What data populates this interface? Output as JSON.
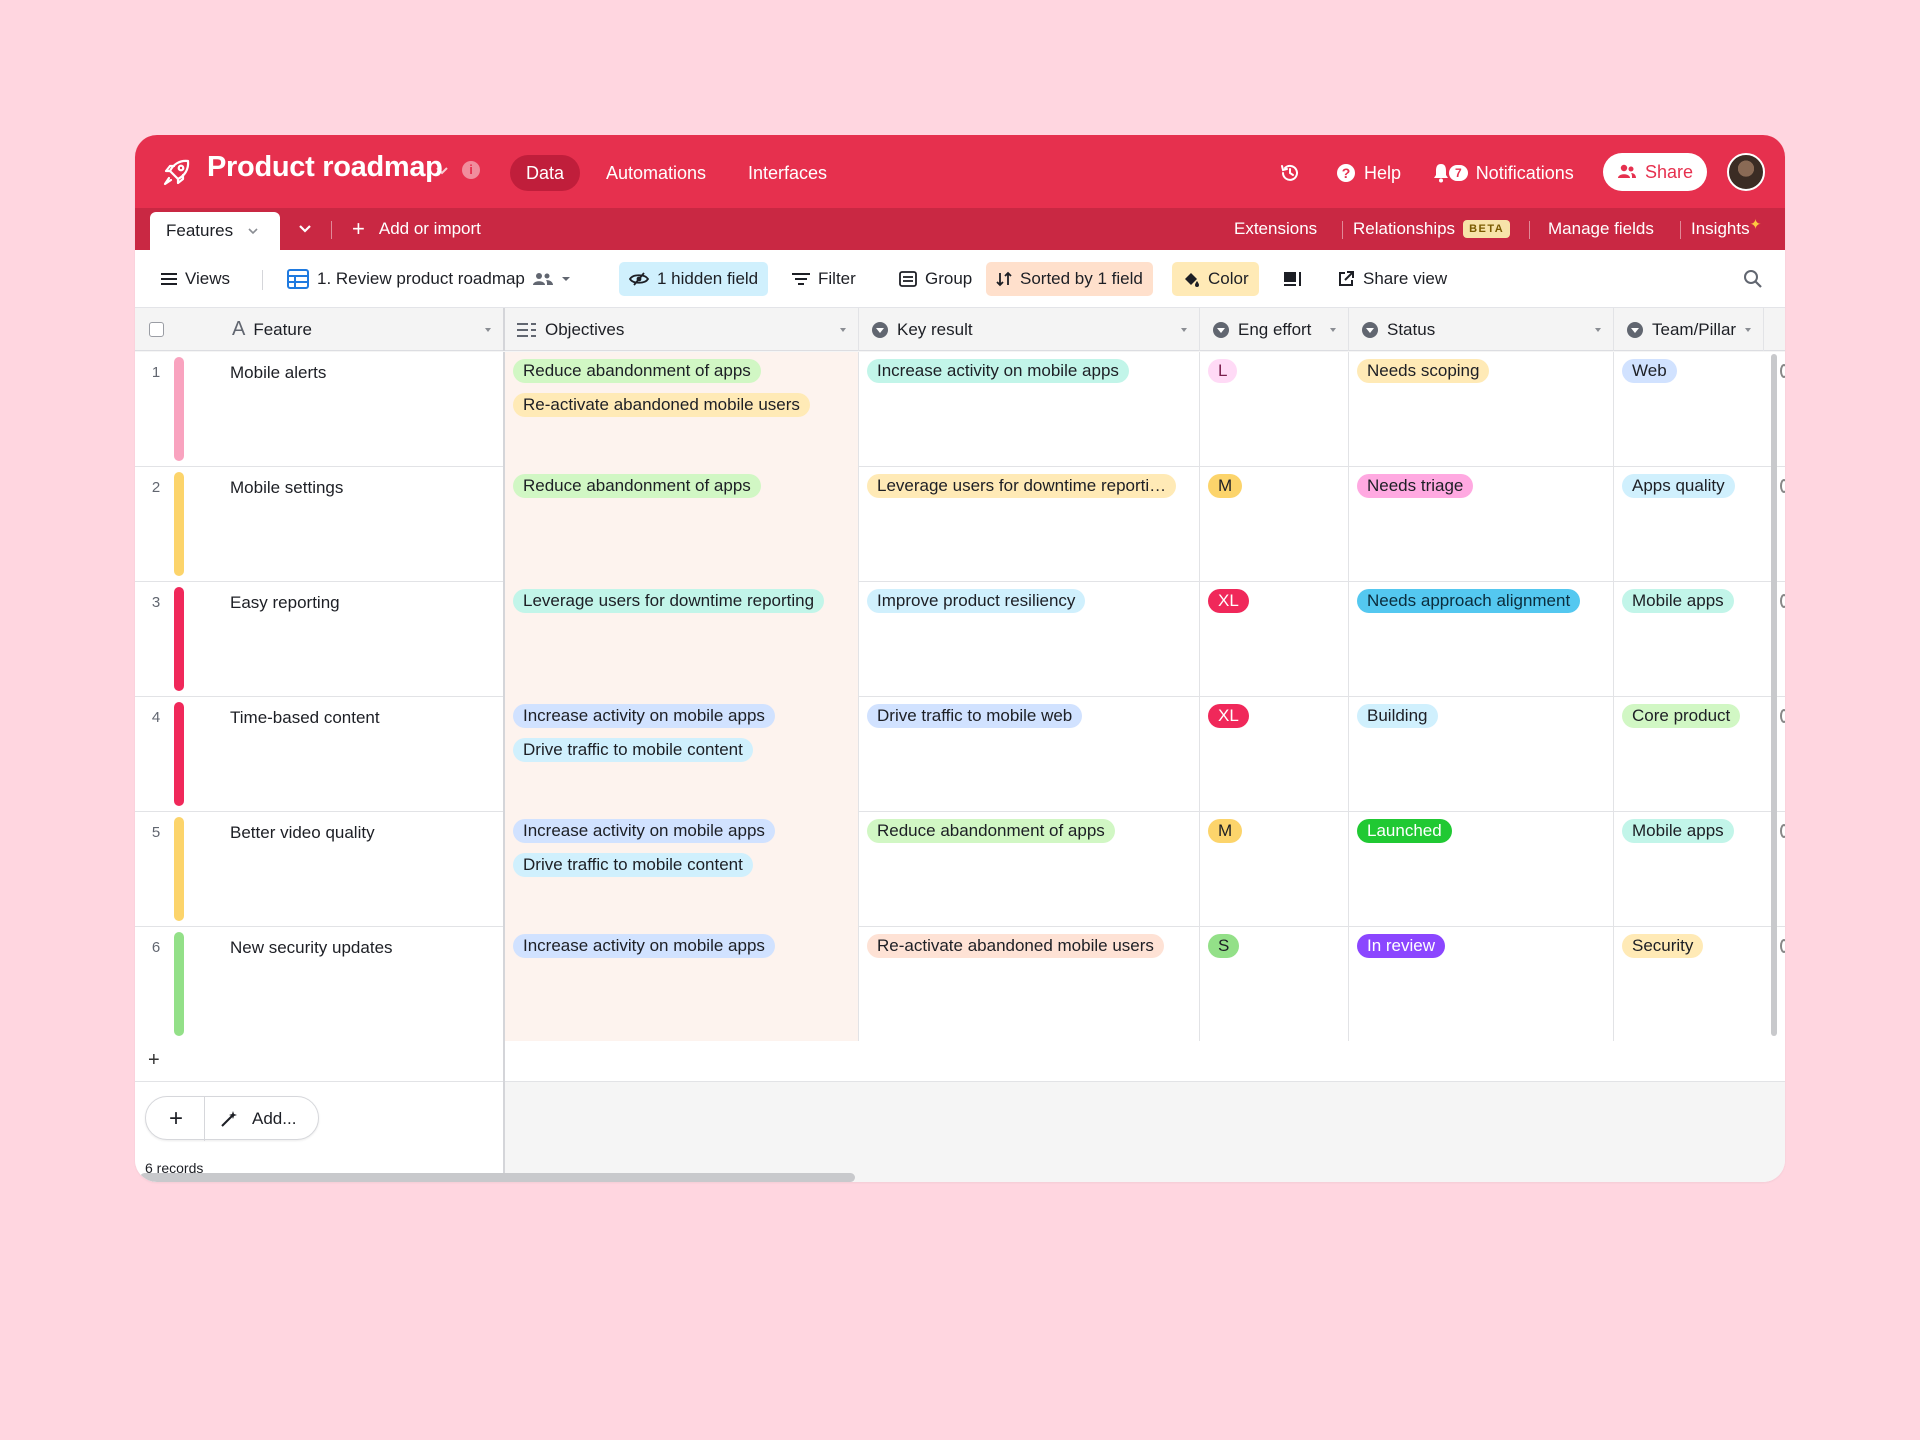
{
  "app": {
    "title": "Product roadmap",
    "nav_tabs": [
      {
        "label": "Data",
        "active": true
      },
      {
        "label": "Automations",
        "active": false
      },
      {
        "label": "Interfaces",
        "active": false
      }
    ],
    "help_label": "Help",
    "notifications_label": "Notifications",
    "notifications_count": "7",
    "share_label": "Share",
    "accent_color": "#e6304e"
  },
  "tablebar": {
    "table_tab": "Features",
    "add_import": "Add or import",
    "extensions": "Extensions",
    "relationships": "Relationships",
    "beta": "BETA",
    "manage_fields": "Manage fields",
    "insights": "Insights"
  },
  "toolbar": {
    "views": "Views",
    "view_name": "1. Review product roadmap",
    "hidden_field": "1 hidden field",
    "filter": "Filter",
    "group": "Group",
    "sorted": "Sorted by 1 field",
    "color": "Color",
    "share_view": "Share view"
  },
  "columns": {
    "feature": "Feature",
    "objectives": "Objectives",
    "key_result": "Key result",
    "eng_effort": "Eng effort",
    "status": "Status",
    "team": "Team/Pillar"
  },
  "rows": [
    {
      "num": "1",
      "bar_color": "#f9a3bf",
      "feature": "Mobile alerts",
      "objectives": [
        {
          "text": "Reduce abandonment of apps",
          "bg": "#d1f7c4"
        },
        {
          "text": "Re-activate abandoned mobile users",
          "bg": "#ffeab6"
        }
      ],
      "key_result": {
        "text": "Increase activity on mobile apps",
        "bg": "#c2f5e9"
      },
      "eng": {
        "text": "L",
        "bg": "#ffdaf6",
        "fg": "#7a1f4d"
      },
      "status": {
        "text": "Needs scoping",
        "bg": "#ffeab6",
        "fg": "#1d1f25"
      },
      "team": {
        "text": "Web",
        "bg": "#d1e2ff"
      }
    },
    {
      "num": "2",
      "bar_color": "#fcd46b",
      "feature": "Mobile settings",
      "objectives": [
        {
          "text": "Reduce abandonment of apps",
          "bg": "#d1f7c4"
        }
      ],
      "key_result": {
        "text": "Leverage users for downtime reporti…",
        "bg": "#ffeab6"
      },
      "eng": {
        "text": "M",
        "bg": "#fcd46b",
        "fg": "#1d1f25"
      },
      "status": {
        "text": "Needs triage",
        "bg": "#ffa9e1",
        "fg": "#1d1f25"
      },
      "team": {
        "text": "Apps quality",
        "bg": "#d0f0fd"
      }
    },
    {
      "num": "3",
      "bar_color": "#f0285a",
      "feature": "Easy reporting",
      "objectives": [
        {
          "text": "Leverage users for downtime reporting",
          "bg": "#c2f5e9"
        }
      ],
      "key_result": {
        "text": "Improve product resiliency",
        "bg": "#d0f0fd"
      },
      "eng": {
        "text": "XL",
        "bg": "#f0285a",
        "fg": "#ffffff"
      },
      "status": {
        "text": "Needs approach alignment",
        "bg": "#54c8f0",
        "fg": "#0b2d3d"
      },
      "team": {
        "text": "Mobile apps",
        "bg": "#c2f5e9"
      }
    },
    {
      "num": "4",
      "bar_color": "#f0285a",
      "feature": "Time-based content",
      "objectives": [
        {
          "text": "Increase activity on mobile apps",
          "bg": "#d1e2ff"
        },
        {
          "text": "Drive traffic to mobile content",
          "bg": "#d0f0fd"
        }
      ],
      "key_result": {
        "text": "Drive traffic to mobile web",
        "bg": "#d1e2ff"
      },
      "eng": {
        "text": "XL",
        "bg": "#f0285a",
        "fg": "#ffffff"
      },
      "status": {
        "text": "Building",
        "bg": "#d0f0fd",
        "fg": "#1d1f25"
      },
      "team": {
        "text": "Core product",
        "bg": "#d1f7c4"
      }
    },
    {
      "num": "5",
      "bar_color": "#fcd46b",
      "feature": "Better video quality",
      "objectives": [
        {
          "text": "Increase activity on mobile apps",
          "bg": "#d1e2ff"
        },
        {
          "text": "Drive traffic to mobile content",
          "bg": "#d0f0fd"
        }
      ],
      "key_result": {
        "text": "Reduce abandonment of apps",
        "bg": "#d1f7c4"
      },
      "eng": {
        "text": "M",
        "bg": "#fcd46b",
        "fg": "#1d1f25"
      },
      "status": {
        "text": "Launched",
        "bg": "#20c933",
        "fg": "#ffffff"
      },
      "team": {
        "text": "Mobile apps",
        "bg": "#c2f5e9"
      }
    },
    {
      "num": "6",
      "bar_color": "#93e088",
      "feature": "New security updates",
      "objectives": [
        {
          "text": "Increase activity on mobile apps",
          "bg": "#d1e2ff"
        }
      ],
      "key_result": {
        "text": "Re-activate abandoned mobile users",
        "bg": "#fee2d5"
      },
      "eng": {
        "text": "S",
        "bg": "#93e088",
        "fg": "#1d1f25"
      },
      "status": {
        "text": "In review",
        "bg": "#8b46ff",
        "fg": "#ffffff"
      },
      "team": {
        "text": "Security",
        "bg": "#ffeab6"
      }
    }
  ],
  "footer": {
    "add_label": "Add...",
    "records": "6 records"
  }
}
